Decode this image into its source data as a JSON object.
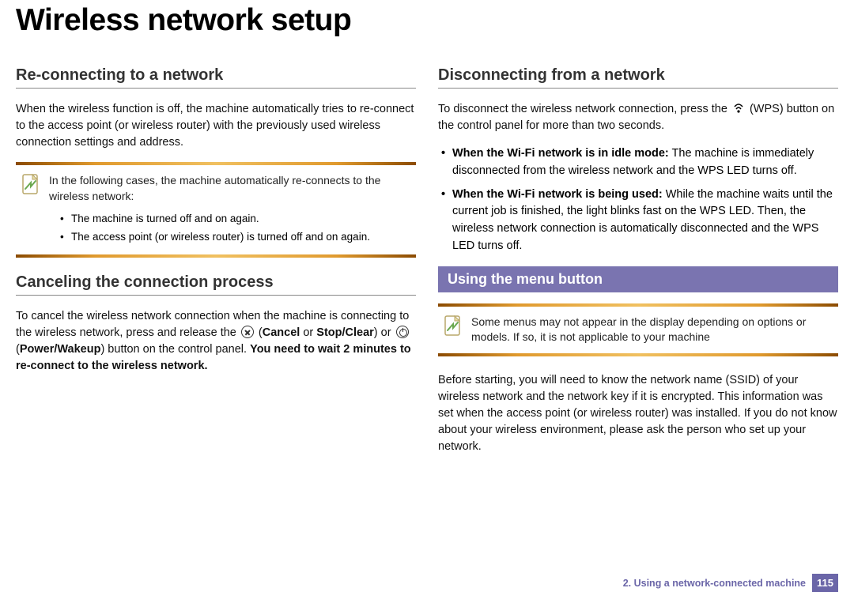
{
  "title": "Wireless network setup",
  "left": {
    "h1": "Re-connecting to a network",
    "p1": "When the wireless function is off, the machine automatically tries to re-connect to the access point (or wireless router) with the previously used wireless connection settings and address.",
    "note1": {
      "lead": "In the following cases, the machine automatically re-connects to the wireless network:",
      "items": [
        "The machine is turned off and on again.",
        "The access point (or wireless router) is turned off and on again."
      ]
    },
    "h2": "Canceling the connection process",
    "p2a": "To cancel the wireless network connection when the machine is connecting to the wireless network, press and release the ",
    "p2b": " (",
    "p2c_bold": "Cancel",
    "p2d": " or ",
    "p2e_bold": "Stop/Clear",
    "p2f": ") or ",
    "p2g": " (",
    "p2h_bold": "Power/Wakeup",
    "p2i": ") button on the control panel. ",
    "p2j_bold": "You need to wait 2 minutes to re-connect to the wireless network."
  },
  "right": {
    "h1": "Disconnecting from a network",
    "p1a": "To disconnect the wireless network connection, press the ",
    "p1b": " (WPS) button on the control panel for more than two seconds.",
    "bullets": [
      {
        "lead_bold": "When the Wi-Fi network is in idle mode:",
        "rest": " The machine is immediately disconnected from the wireless network and the WPS LED turns off."
      },
      {
        "lead_bold": "When the Wi-Fi network is being used:",
        "rest": " While the machine waits until the current job is finished, the light blinks fast on the WPS LED. Then, the wireless network connection is automatically disconnected and the WPS LED turns off."
      }
    ],
    "bar": "Using the menu button",
    "note": "Some menus may not appear in the display depending on options or models. If so, it is not applicable to your machine",
    "p2": "Before starting, you will need to know the network name (SSID) of your wireless network and the network key if it is encrypted. This information was set when the access point (or wireless router) was installed. If you do not know about your wireless environment, please ask the person who set up your network."
  },
  "footer": {
    "chapter": "2.  Using a network-connected machine",
    "page": "115"
  }
}
